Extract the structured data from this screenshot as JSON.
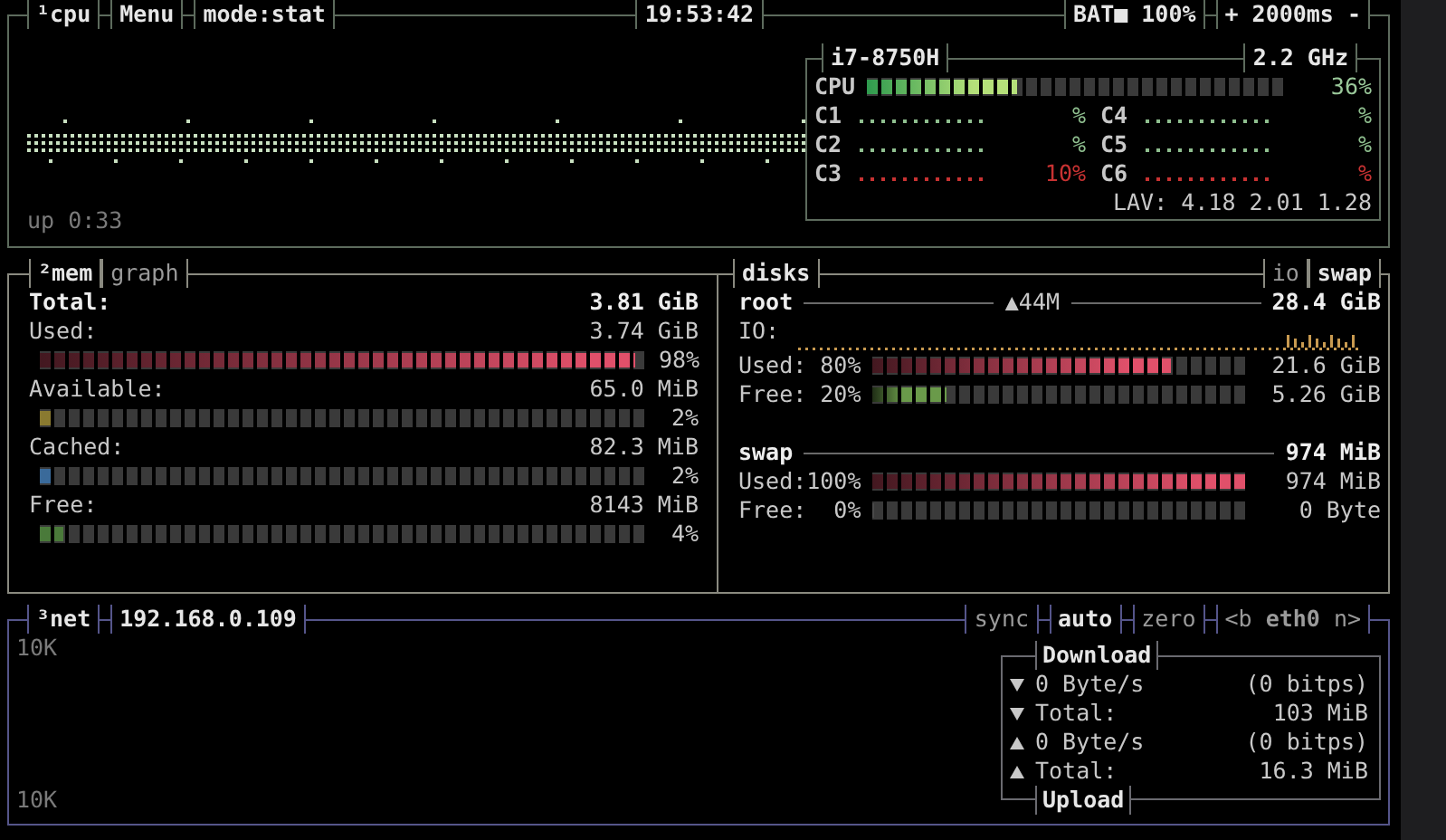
{
  "cpu_panel": {
    "tabs": [
      {
        "label": "¹cpu"
      },
      {
        "label": "Menu"
      },
      {
        "label": "mode:stat"
      }
    ],
    "clock": "19:53:42",
    "battery": "BAT■ 100%",
    "update": "+ 2000ms -",
    "uptime": "up 0:33",
    "cpu_box": {
      "model": "i7-8750H",
      "frequency": "2.2 GHz",
      "total": {
        "label": "CPU",
        "level": 0.36,
        "reading": "36%"
      },
      "cores": [
        {
          "name": "C1",
          "reading": "%",
          "color": "#8fbf8f"
        },
        {
          "name": "C2",
          "reading": "%",
          "color": "#8fbf8f"
        },
        {
          "name": "C3",
          "reading": "10%",
          "color": "#c83232"
        },
        {
          "name": "C4",
          "reading": "%",
          "color": "#8fbf8f"
        },
        {
          "name": "C5",
          "reading": "%",
          "color": "#8fbf8f"
        },
        {
          "name": "C6",
          "reading": "%",
          "color": "#c83232"
        }
      ],
      "load": "LAV: 4.18 2.01 1.28"
    }
  },
  "mem_panel": {
    "tabs": [
      {
        "label": "²mem"
      },
      {
        "label": "graph"
      }
    ],
    "total": {
      "label": "Total:",
      "value": "3.81 GiB"
    },
    "items": [
      {
        "label": "Used:",
        "value": "3.74 GiB",
        "level": 0.98,
        "percent": "98%",
        "color": "#e0506a"
      },
      {
        "label": "Available:",
        "value": "65.0 MiB",
        "level": 0.02,
        "percent": "2%",
        "color": "#8a7a30"
      },
      {
        "label": "Cached:",
        "value": "82.3 MiB",
        "level": 0.02,
        "percent": "2%",
        "color": "#3a6a9a"
      },
      {
        "label": "Free:",
        "value": "8143 MiB",
        "level": 0.04,
        "percent": "4%",
        "color": "#4a7a3a"
      }
    ]
  },
  "disks_panel": {
    "tabs": [
      {
        "label": "disks"
      }
    ],
    "right_tabs": [
      {
        "label": "io"
      },
      {
        "label": "swap"
      }
    ],
    "disks": [
      {
        "name": "root",
        "io": "▲44M",
        "size": "28.4 GiB",
        "io_label": "IO:",
        "rows": [
          {
            "label": "Used: 80%",
            "value": "21.6 GiB",
            "level": 0.8,
            "color": "#e0506a"
          },
          {
            "label": "Free: 20%",
            "value": "5.26 GiB",
            "level": 0.2,
            "color": "#6a9a4a"
          }
        ]
      },
      {
        "name": "swap",
        "size": "974 MiB",
        "rows": [
          {
            "label": "Used:100%",
            "value": "974 MiB",
            "level": 1.0,
            "color": "#e0506a"
          },
          {
            "label": "Free:  0%",
            "value": "0 Byte",
            "level": 0
          }
        ]
      }
    ]
  },
  "net_panel": {
    "tabs": [
      {
        "label": "³net"
      },
      {
        "label": "192.168.0.109"
      }
    ],
    "controls": [
      {
        "label": "sync",
        "selected": false
      },
      {
        "label": "auto",
        "selected": true
      },
      {
        "label": "zero",
        "selected": false
      },
      {
        "label": "<b **eth0** n>",
        "selected": false
      }
    ],
    "graph_labels": [
      "10K",
      "10K"
    ],
    "stats": {
      "top_title": "Download",
      "bottom_title": "Upload",
      "rows": [
        {
          "kind": "down",
          "label": "0 Byte/s",
          "value": "(0 bitps)"
        },
        {
          "kind": "down",
          "label": "Total:",
          "value": "103 MiB"
        },
        {
          "kind": "up",
          "label": "0 Byte/s",
          "value": "(0 bitps)"
        },
        {
          "kind": "up",
          "label": "Total:",
          "value": "16.3 MiB"
        }
      ]
    }
  }
}
